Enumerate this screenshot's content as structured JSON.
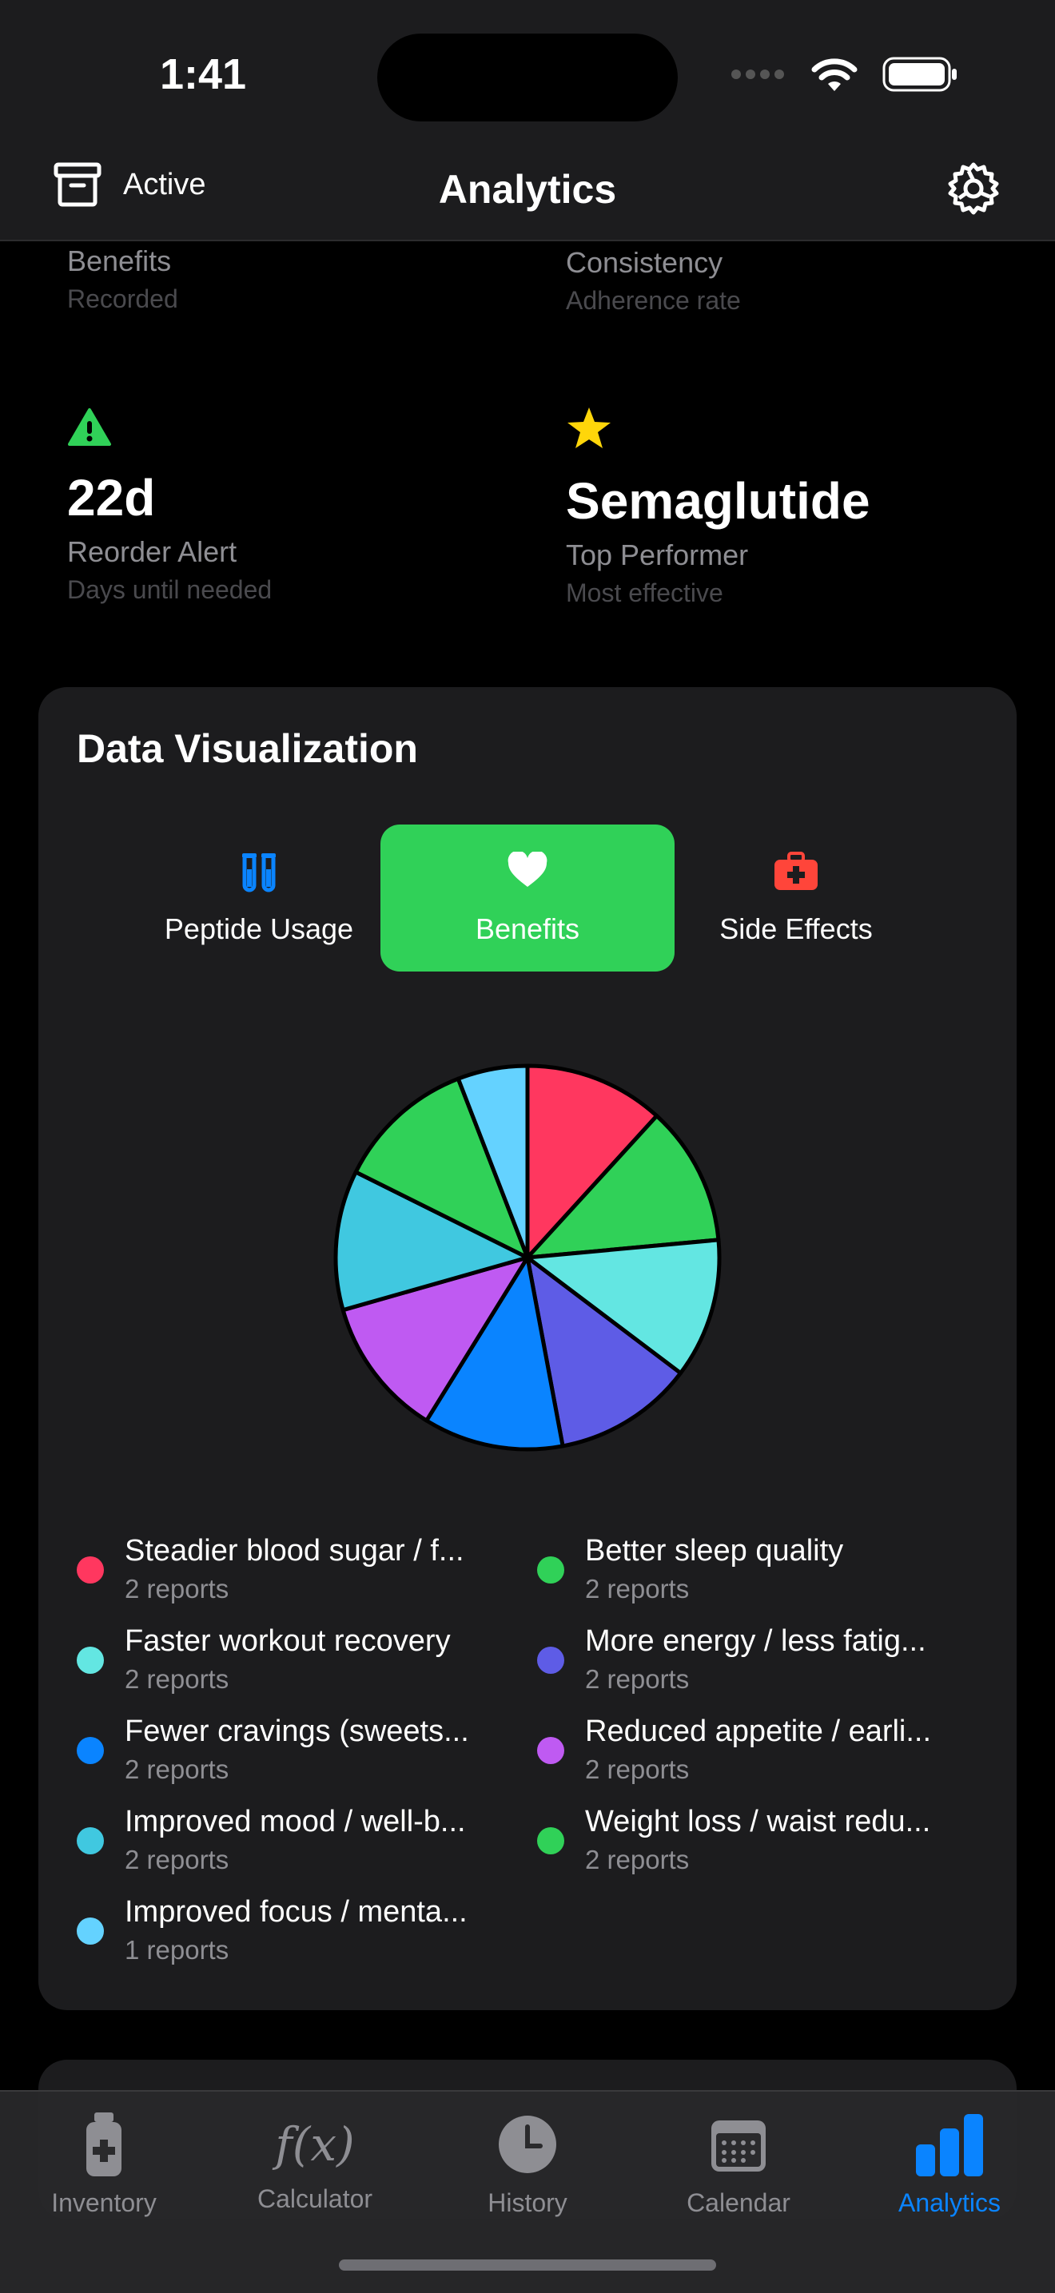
{
  "status_bar": {
    "time": "1:41"
  },
  "nav": {
    "left_label": "Active",
    "title": "Analytics"
  },
  "stats": [
    {
      "label": "Benefits",
      "sub": "Recorded"
    },
    {
      "label": "Consistency",
      "sub": "Adherence rate"
    },
    {
      "value": "22d",
      "label": "Reorder Alert",
      "sub": "Days until needed",
      "icon": "warning-icon",
      "icon_color": "#30d158"
    },
    {
      "value": "Semaglutide",
      "label": "Top Performer",
      "sub": "Most effective",
      "icon": "star-icon",
      "icon_color": "#ffd60a"
    }
  ],
  "card": {
    "title": "Data Visualization",
    "tabs": [
      {
        "label": "Peptide Usage",
        "icon": "test-tubes-icon",
        "icon_color": "#0a84ff",
        "active": false
      },
      {
        "label": "Benefits",
        "icon": "heart-icon",
        "icon_color": "#ffffff",
        "active": true
      },
      {
        "label": "Side Effects",
        "icon": "medical-kit-icon",
        "icon_color": "#ff453a",
        "active": false
      }
    ]
  },
  "chart_data": {
    "type": "pie",
    "slices": [
      {
        "name": "Steadier blood sugar / f...",
        "value": 2,
        "count_label": "2 reports",
        "color": "#ff375f"
      },
      {
        "name": "Better sleep quality",
        "value": 2,
        "count_label": "2 reports",
        "color": "#30d158"
      },
      {
        "name": "Faster workout recovery",
        "value": 2,
        "count_label": "2 reports",
        "color": "#63e6e2"
      },
      {
        "name": "More energy / less fatig...",
        "value": 2,
        "count_label": "2 reports",
        "color": "#5e5ce6"
      },
      {
        "name": "Fewer cravings (sweets...",
        "value": 2,
        "count_label": "2 reports",
        "color": "#0a84ff"
      },
      {
        "name": "Reduced appetite / earli...",
        "value": 2,
        "count_label": "2 reports",
        "color": "#bf5af2"
      },
      {
        "name": "Improved mood / well-b...",
        "value": 2,
        "count_label": "2 reports",
        "color": "#40c8e0"
      },
      {
        "name": "Weight loss / waist redu...",
        "value": 2,
        "count_label": "2 reports",
        "color": "#30d158"
      },
      {
        "name": "Improved focus / menta...",
        "value": 1,
        "count_label": "1 reports",
        "color": "#64d2ff"
      }
    ]
  },
  "tabbar": {
    "items": [
      {
        "label": "Inventory",
        "icon": "vial-icon",
        "active": false
      },
      {
        "label": "Calculator",
        "icon": "function-icon",
        "icon_text": "f(x)",
        "active": false
      },
      {
        "label": "History",
        "icon": "clock-icon",
        "active": false
      },
      {
        "label": "Calendar",
        "icon": "calendar-icon",
        "active": false
      },
      {
        "label": "Analytics",
        "icon": "bar-chart-icon",
        "active": true
      }
    ],
    "active_color": "#0a84ff"
  }
}
